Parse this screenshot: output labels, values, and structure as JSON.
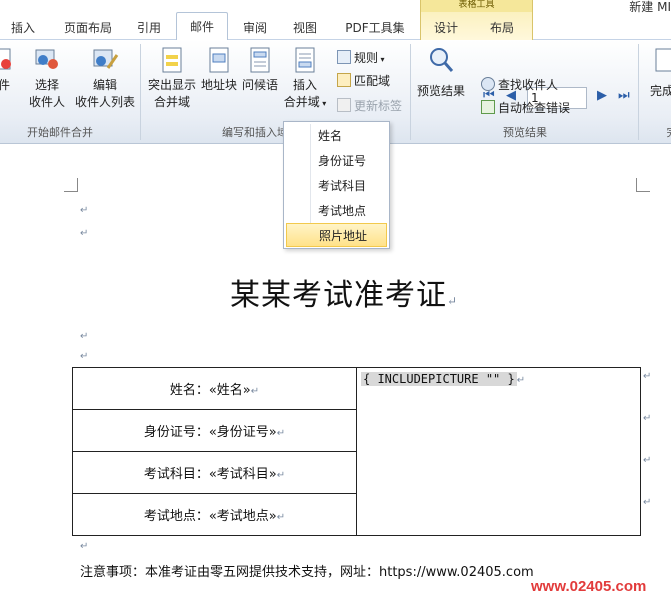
{
  "window": {
    "title_partial": "新建 MI"
  },
  "tabs": [
    {
      "label": "插入"
    },
    {
      "label": "页面布局"
    },
    {
      "label": "引用"
    },
    {
      "label": "邮件"
    },
    {
      "label": "审阅"
    },
    {
      "label": "视图"
    },
    {
      "label": "PDF工具集"
    },
    {
      "label": "设计"
    },
    {
      "label": "布局"
    }
  ],
  "context_tab_group": "表格工具",
  "ribbon": {
    "start_group": {
      "label": "开始邮件合并",
      "partial_btn": "件",
      "select_recipients": [
        "选择",
        "收件人"
      ],
      "edit_recipients": [
        "编辑",
        "收件人列表"
      ]
    },
    "write_group": {
      "label": "编写和插入域",
      "highlight_fields": [
        "突出显示",
        "合并域"
      ],
      "address_block": "地址块",
      "greeting_line": "问候语",
      "insert_merge_field": [
        "插入",
        "合并域"
      ],
      "rules": "规则",
      "match_fields": "匹配域",
      "update_labels": "更新标签"
    },
    "preview_group": {
      "label": "预览结果",
      "preview_results": "预览结果",
      "record_value": "1",
      "find_recipient": "查找收件人",
      "auto_check": "自动检查错误"
    },
    "finish_group": {
      "label": "完",
      "finish": "完成"
    }
  },
  "dropdown": {
    "items": [
      "姓名",
      "身份证号",
      "考试科目",
      "考试地点",
      "照片地址"
    ],
    "highlighted": "照片地址"
  },
  "document": {
    "title": "某某考试准考证",
    "rows": [
      {
        "label": "姓名：",
        "field": "«姓名»"
      },
      {
        "label": "身份证号：",
        "field": "«身份证号»"
      },
      {
        "label": "考试科目：",
        "field": "«考试科目»"
      },
      {
        "label": "考试地点：",
        "field": "«考试地点»"
      }
    ],
    "field_code": "{ INCLUDEPICTURE \"\" }",
    "note": "注意事项：本准考证由零五网提供技术支持，网址：https://www.02405.com",
    "para_mark": "↵"
  },
  "watermark": "www.02405.com",
  "colors": {
    "accent": "#2b5ea8",
    "watermark": "#e23b3b",
    "context_tab": "#f5e79a"
  }
}
